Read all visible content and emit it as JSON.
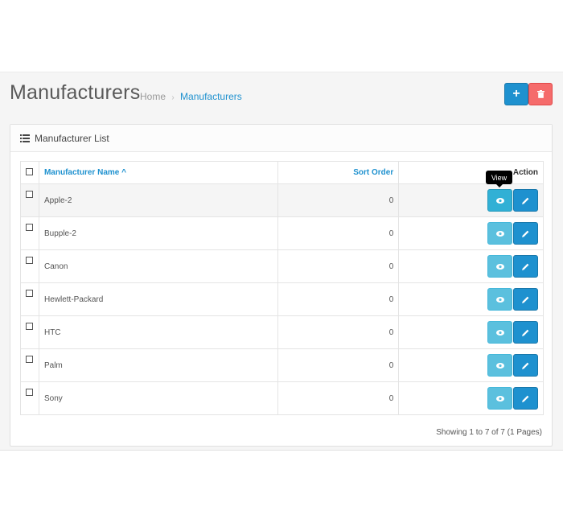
{
  "header": {
    "title": "Manufacturers",
    "breadcrumb": [
      {
        "label": "Home"
      },
      {
        "label": "Manufacturers"
      }
    ],
    "add_button_icon": "plus-icon",
    "delete_button_icon": "trash-icon"
  },
  "panel": {
    "title": "Manufacturer List",
    "title_icon": "list-icon"
  },
  "table": {
    "columns": {
      "name": "Manufacturer Name",
      "sort_order": "Sort Order",
      "action": "Action"
    },
    "sort_indicator": "caret-up-icon",
    "rows": [
      {
        "name": "Apple-2",
        "sort_order": "0"
      },
      {
        "name": "Bupple-2",
        "sort_order": "0"
      },
      {
        "name": "Canon",
        "sort_order": "0"
      },
      {
        "name": "Hewlett-Packard",
        "sort_order": "0"
      },
      {
        "name": "HTC",
        "sort_order": "0"
      },
      {
        "name": "Palm",
        "sort_order": "0"
      },
      {
        "name": "Sony",
        "sort_order": "0"
      }
    ]
  },
  "tooltip": "View",
  "pagination": {
    "summary": "Showing 1 to 7 of 7 (1 Pages)"
  },
  "colors": {
    "primary": "#1e91cf",
    "danger": "#f56b6b",
    "info": "#5bc0de"
  }
}
